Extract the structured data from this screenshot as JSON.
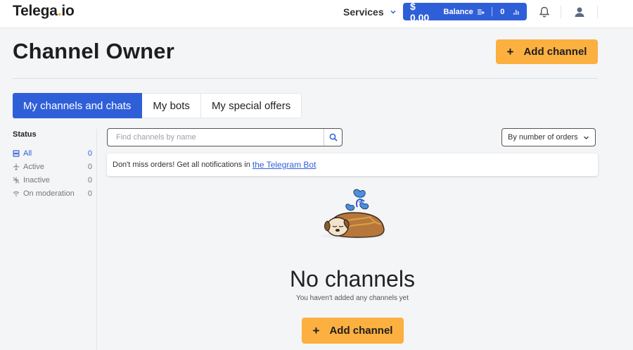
{
  "header": {
    "logo": {
      "main": "Telega",
      "dot": ".",
      "tld": "io"
    },
    "services_label": "Services",
    "balance": {
      "amount": "$ 0.00",
      "label": "Balance",
      "count": "0"
    },
    "icons": [
      "chevron-down-icon",
      "wallet-plus-icon",
      "bar-chart-icon",
      "bell-icon",
      "user-icon"
    ]
  },
  "page": {
    "title": "Channel Owner",
    "add_label": "Add channel",
    "add_icon": "+"
  },
  "tabs": [
    {
      "label": "My channels and chats",
      "active": true
    },
    {
      "label": "My bots",
      "active": false
    },
    {
      "label": "My special offers",
      "active": false
    }
  ],
  "sidebar": {
    "title": "Status",
    "items": [
      {
        "label": "All",
        "count": "0",
        "icon": "server-icon",
        "active": true
      },
      {
        "label": "Active",
        "count": "0",
        "icon": "plane-icon",
        "active": false
      },
      {
        "label": "Inactive",
        "count": "0",
        "icon": "plane-off-icon",
        "active": false
      },
      {
        "label": "On moderation",
        "count": "0",
        "icon": "wifi-icon",
        "active": false
      }
    ]
  },
  "search": {
    "placeholder": "Find channels by name",
    "value": ""
  },
  "sort": {
    "selected": "By number of orders"
  },
  "notice": {
    "text": "Don't miss orders! Get all notifications in",
    "link": "the Telegram Bot"
  },
  "empty": {
    "title": "No channels",
    "subtitle": "You haven't added any channels yet"
  },
  "colors": {
    "primary": "#2f5fd8",
    "accent": "#fbb040",
    "background": "#f4f5f7"
  }
}
